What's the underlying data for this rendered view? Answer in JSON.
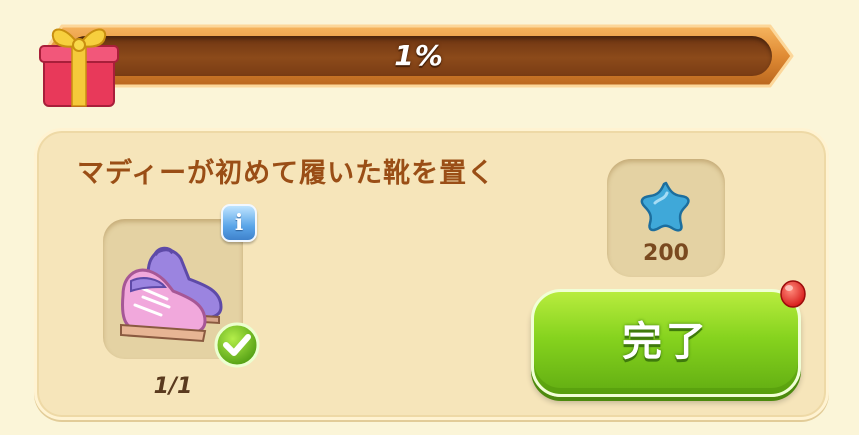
{
  "progress": {
    "label": "1%",
    "fraction": 0.01
  },
  "quest": {
    "title": "マディーが初めて履いた靴を置く",
    "item": {
      "icon": "pink-shoes-icon",
      "count": "1/1",
      "completed": true
    },
    "reward": {
      "icon": "blue-star-icon",
      "amount": "200"
    },
    "complete_button_label": "完了"
  },
  "colors": {
    "accent_green": "#86d31e",
    "title_brown": "#9a4e16",
    "bar_brown": "#8c4a1a",
    "background": "#fbf5d8"
  }
}
